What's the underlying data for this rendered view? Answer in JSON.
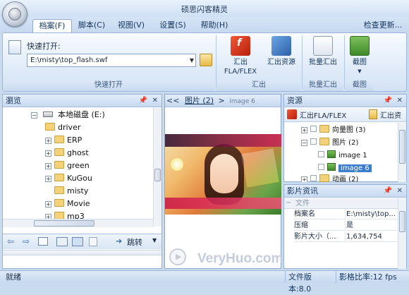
{
  "app": {
    "title": "硕思闪客精灵"
  },
  "menu_tabs": [
    "档案(F)",
    "脚本(C)",
    "视图(V)",
    "设置(S)",
    "帮助(H)"
  ],
  "check_update": "检查更新...",
  "ribbon": {
    "quick_open": {
      "label": "快速打开:",
      "path": "E:\\misty\\top_flash.swf",
      "group_label": "快速打开"
    },
    "export": {
      "btn1": "汇出FLA/FLEX",
      "btn2": "汇出资源",
      "group_label": "汇出"
    },
    "batch": {
      "btn": "批量汇出",
      "group_label": "批量汇出"
    },
    "screenshot": {
      "btn": "截图",
      "group_label": "截图"
    }
  },
  "browse": {
    "title": "瀏览",
    "drive": "本地磁盘 (E:)",
    "folders": [
      "driver",
      "ERP",
      "ghost",
      "green",
      "KuGou",
      "misty",
      "Movie",
      "mp3"
    ],
    "jump_label": "跳转"
  },
  "preview": {
    "nav_back": "<<",
    "nav_forward": ">>",
    "breadcrumb": "图片 (2)",
    "breadcrumb_sep": ">",
    "current": "image 6",
    "watermark": "VeryHuo.com"
  },
  "resources": {
    "title": "资源",
    "toolbar_export": "汇出FLA/FLEX",
    "toolbar_export2": "汇出资",
    "items": [
      {
        "label": "向量图 (3)"
      },
      {
        "label": "图片 (2)"
      },
      {
        "label": "image 1"
      },
      {
        "label": "image 6"
      },
      {
        "label": "动画 (2)"
      }
    ]
  },
  "movie_info": {
    "title": "影片资讯",
    "section": "文件",
    "rows": [
      {
        "key": "档案名",
        "value": "E:\\misty\\top..."
      },
      {
        "key": "压缩",
        "value": "是"
      },
      {
        "key": "影片大小（...",
        "value": "1,634,754"
      }
    ]
  },
  "status": {
    "ready": "就绪",
    "file_version": "文件版本:8.0",
    "frame_rate": "影格比率:12 fps"
  },
  "colors": {
    "accent": "#2f6fc1",
    "selection": "#3b7ed0"
  }
}
